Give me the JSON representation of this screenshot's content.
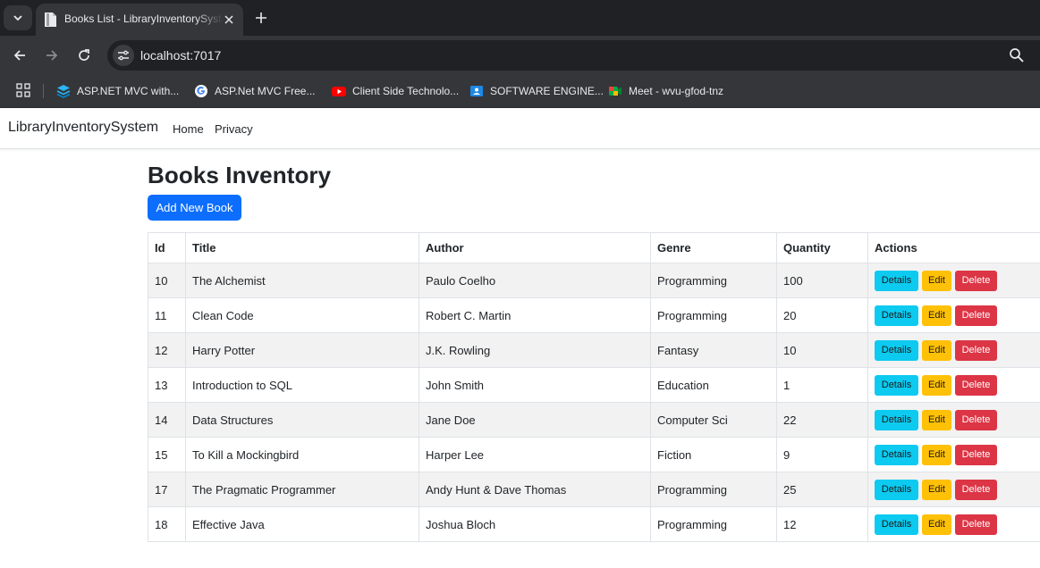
{
  "browser": {
    "tab_title": "Books List - LibraryInventorySystem",
    "url": "localhost:7017",
    "bookmarks": [
      {
        "label": "ASP.NET MVC with...",
        "icon": "layers-icon"
      },
      {
        "label": "ASP.Net MVC Free...",
        "icon": "google-icon"
      },
      {
        "label": "Client Side Technolo...",
        "icon": "youtube-icon"
      },
      {
        "label": "SOFTWARE ENGINE...",
        "icon": "classroom-icon"
      },
      {
        "label": "Meet - wvu-gfod-tnz",
        "icon": "meet-icon"
      }
    ]
  },
  "site": {
    "brand": "LibraryInventorySystem",
    "nav": [
      "Home",
      "Privacy"
    ]
  },
  "page": {
    "title": "Books Inventory",
    "add_button": "Add New Book"
  },
  "table": {
    "headers": [
      "Id",
      "Title",
      "Author",
      "Genre",
      "Quantity",
      "Actions"
    ],
    "action_labels": {
      "details": "Details",
      "edit": "Edit",
      "delete": "Delete"
    },
    "rows": [
      {
        "id": "10",
        "title": "The Alchemist",
        "author": "Paulo Coelho",
        "genre": "Programming",
        "quantity": "100"
      },
      {
        "id": "11",
        "title": "Clean Code",
        "author": "Robert C. Martin",
        "genre": "Programming",
        "quantity": "20"
      },
      {
        "id": "12",
        "title": "Harry Potter",
        "author": "J.K. Rowling",
        "genre": "Fantasy",
        "quantity": "10"
      },
      {
        "id": "13",
        "title": "Introduction to SQL",
        "author": "John Smith",
        "genre": "Education",
        "quantity": "1"
      },
      {
        "id": "14",
        "title": "Data Structures",
        "author": "Jane Doe",
        "genre": "Computer Sci",
        "quantity": "22"
      },
      {
        "id": "15",
        "title": "To Kill a Mockingbird",
        "author": "Harper Lee",
        "genre": "Fiction",
        "quantity": "9"
      },
      {
        "id": "17",
        "title": "The Pragmatic Programmer",
        "author": "Andy Hunt & Dave Thomas",
        "genre": "Programming",
        "quantity": "25"
      },
      {
        "id": "18",
        "title": "Effective Java",
        "author": "Joshua Bloch",
        "genre": "Programming",
        "quantity": "12"
      }
    ]
  },
  "colors": {
    "primary": "#0d6efd",
    "info": "#0dcaf0",
    "warning": "#ffc107",
    "danger": "#dc3545"
  }
}
